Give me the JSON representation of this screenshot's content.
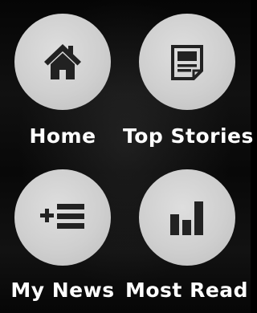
{
  "menu": {
    "items": [
      {
        "label": "Home",
        "icon": "home-icon"
      },
      {
        "label": "Top Stories",
        "icon": "newspaper-icon"
      },
      {
        "label": "My News",
        "icon": "add-list-icon"
      },
      {
        "label": "Most Read",
        "icon": "bar-chart-icon"
      }
    ]
  },
  "colors": {
    "background": "#000000",
    "button": "#d3d3d3",
    "icon": "#222222",
    "label": "#ffffff"
  }
}
